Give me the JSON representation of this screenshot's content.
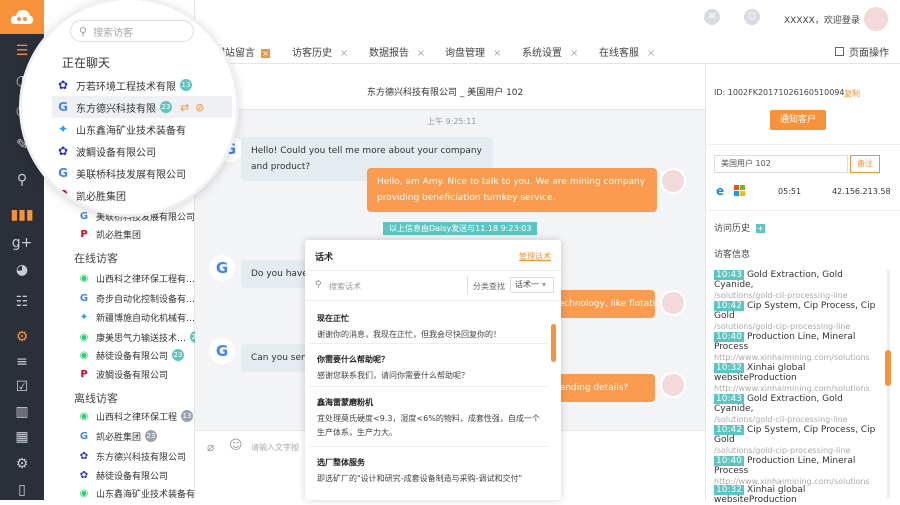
{
  "header": {
    "user_name": "XXXXX",
    "welcome_text": "，欢迎登录",
    "page_ops_label": "页面操作"
  },
  "tabs": [
    {
      "label": "网站留言"
    },
    {
      "label": "访客历史"
    },
    {
      "label": "数据报告"
    },
    {
      "label": "询盘管理"
    },
    {
      "label": "系统设置"
    },
    {
      "label": "在线客服"
    }
  ],
  "list": {
    "chatting_title": "正在聊天",
    "online_title": "在线访客",
    "left_title": "离线访客",
    "chatting": [
      {
        "name": "万若环境工程技术有限",
        "badge": "13",
        "icon": "paw-icon"
      },
      {
        "name": "东方德兴科技有限",
        "badge": "23",
        "icon": "google-icon"
      },
      {
        "name": "山东鑫海矿业技术装备有",
        "badge": "",
        "icon": "twitter-icon"
      },
      {
        "name": "波鲷设备有限公司",
        "badge": "",
        "icon": "paw-icon"
      },
      {
        "name": "美联桥科技发展有限公司",
        "badge": "",
        "icon": "google-icon"
      },
      {
        "name": "凯必胜集团",
        "badge": "",
        "icon": "pinterest-icon"
      }
    ],
    "chatting_extra": [
      {
        "name": "美联桥科技发展有限公司",
        "icon": "google-icon"
      },
      {
        "name": "凯必胜集团",
        "icon": "pinterest-icon"
      }
    ],
    "online": [
      {
        "name": "山西科之律环保工程有…",
        "badge": "",
        "icon": "whatsapp-icon"
      },
      {
        "name": "奇步自动化控制设备有…",
        "badge": "",
        "icon": "google-icon"
      },
      {
        "name": "新疆博施自动化机械有…",
        "badge": "",
        "icon": "twitter-icon"
      },
      {
        "name": "康美思气力输送技术…",
        "badge": "23",
        "icon": "whatsapp-icon"
      },
      {
        "name": "赫徒设备有限公司",
        "badge": "23",
        "icon": "whatsapp-icon"
      },
      {
        "name": "波鲷设备有限公司",
        "badge": "",
        "icon": "pinterest-icon"
      }
    ],
    "left": [
      {
        "name": "山西科之律环保工程",
        "badge": "13",
        "icon": "whatsapp-icon"
      },
      {
        "name": "凯必胜集团",
        "badge": "23",
        "icon": "google-icon"
      },
      {
        "name": "东方德兴科技有限公司",
        "badge": "",
        "icon": "paw-icon"
      },
      {
        "name": "赫徒设备有限公司",
        "badge": "",
        "icon": "paw-icon"
      },
      {
        "name": "山东鑫海矿业技术装备有",
        "badge": "",
        "icon": "whatsapp-icon"
      }
    ]
  },
  "search": {
    "placeholder": "搜索访客"
  },
  "chat": {
    "header": "东方德兴科技有限公司 _ 美国用户 102",
    "time1": "上午 9:25:11",
    "msg_in_1": "Hello! Could you tell me more about your company and product?",
    "msg_out_1": "Hello, am Amy. Nice to talk to you. We are mining company providing beneficiation turnkey service.",
    "notice": "以上信息由Daisy发送与11.18 9:23:03",
    "msg_in_2": "Do you have t",
    "msg_out_2_tail": "technology, like flotation.",
    "msg_in_3": "Can you send r",
    "msg_out_3_tail": "sending details?",
    "input_placeholder": "请输入文字按"
  },
  "popup": {
    "title": "话术",
    "manage_link": "管理话术",
    "search_placeholder": "搜索话术",
    "category_label": "分类查找",
    "category_value": "话术一",
    "items": [
      {
        "title": "现在正忙",
        "body": "谢谢你的消息，我现在正忙，但我会尽快回复你的！"
      },
      {
        "title": "你需要什么帮助呢？",
        "body": "感谢您联系我们，请问你需要什么帮助呢？"
      },
      {
        "title": "鑫海雷蒙磨粉机",
        "body": "宜处理莫氏硬度<9.3，湿度<6%的物料，成套性强，自成一个生产体系，生产力大。"
      },
      {
        "title": "选厂整体服务",
        "body": "即选矿厂的\"设计和研究-成套设备制造与采购-调试和交付\""
      }
    ]
  },
  "right": {
    "id_text": "ID: 1002FK20171026160510094",
    "copy_label": "复制",
    "notify_button": "通知客户",
    "name_value": "美国用户 102",
    "note_button": "备注",
    "time": "05:51",
    "ip": "42.156.213.58",
    "history_title": "访问历史",
    "info_title": "访客信息",
    "history": [
      {
        "time": "10:43",
        "title": "Gold Extraction, Gold Cyanide,",
        "url": "/solutions/gold-cil-processing-line"
      },
      {
        "time": "10:42",
        "title": "Cip System, Cip Process, Cip Gold",
        "url": "/solutions/gold-cip-processing-line"
      },
      {
        "time": "10:40",
        "title": "Production Line, Mineral Process",
        "url": "http://www.xinhaimining.com/solutions"
      },
      {
        "time": "10:32",
        "title": "Xinhai global websiteProduction",
        "url": "http://www.xinhaimining.com/solutions"
      },
      {
        "time": "10:43",
        "title": "Gold Extraction, Gold Cyanide,",
        "url": "/solutions/gold-cil-processing-line"
      },
      {
        "time": "10:42",
        "title": "Cip System, Cip Process, Cip Gold",
        "url": "/solutions/gold-cip-processing-line"
      },
      {
        "time": "10:40",
        "title": "Production Line, Mineral Process",
        "url": "http://www.xinhaimining.com/solutions"
      },
      {
        "time": "10:32",
        "title": "Xinhai global websiteProduction",
        "url": ""
      }
    ]
  },
  "colors": {
    "accent": "#f7923a",
    "teal": "#5bc6c1",
    "rail": "#2b2f3a"
  }
}
